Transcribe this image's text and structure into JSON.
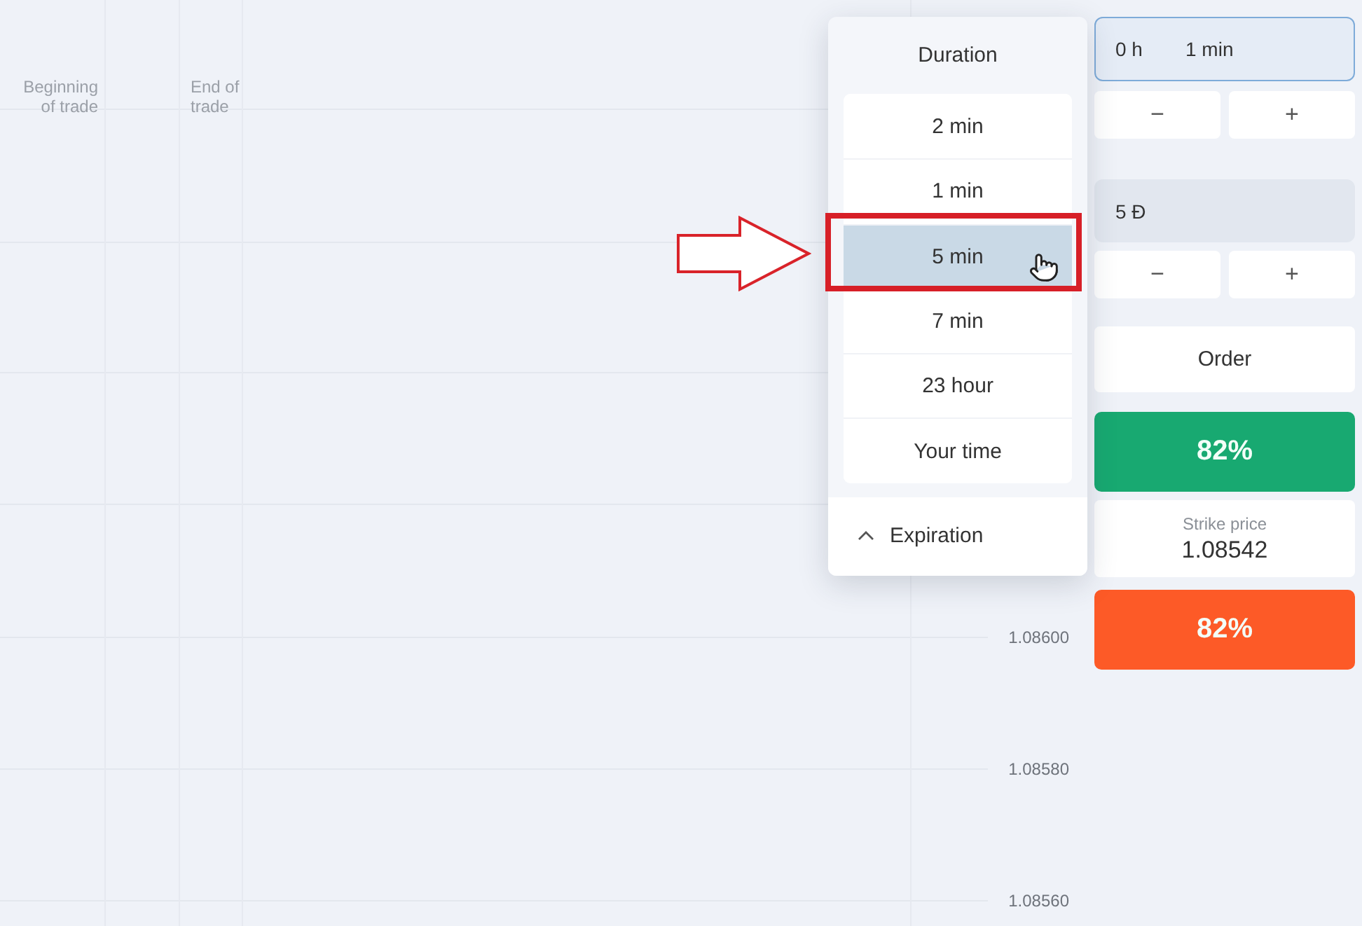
{
  "chart": {
    "markers": [
      "Beginning of trade",
      "End of trade"
    ],
    "price_axis": [
      "1.08600",
      "1.08580",
      "1.08560"
    ]
  },
  "duration_menu": {
    "title": "Duration",
    "options": [
      {
        "label": "2 min",
        "selected": false
      },
      {
        "label": "1 min",
        "selected": false
      },
      {
        "label": "5 min",
        "selected": true
      },
      {
        "label": "7 min",
        "selected": false
      },
      {
        "label": "23 hour",
        "selected": false
      },
      {
        "label": "Your time",
        "selected": false
      }
    ],
    "footer": "Expiration"
  },
  "trade_panel": {
    "time_field": {
      "hours": "0 h",
      "minutes": "1 min",
      "focused": true
    },
    "time_steppers": [
      "−",
      "+"
    ],
    "amount_field": {
      "value": "5 Đ",
      "focused": false
    },
    "amount_steppers": [
      "−",
      "+"
    ],
    "order_label": "Order",
    "buy_button": "82%",
    "strike": {
      "label": "Strike price",
      "value": "1.08542"
    },
    "sell_button": "82%"
  }
}
